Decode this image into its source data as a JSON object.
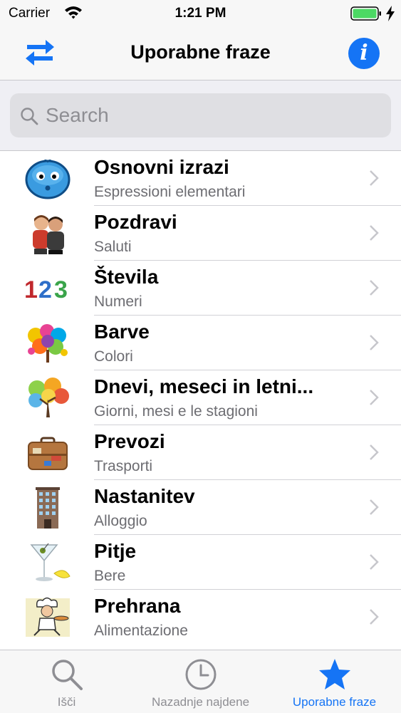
{
  "status_bar": {
    "carrier": "Carrier",
    "time": "1:21 PM"
  },
  "nav": {
    "title": "Uporabne fraze",
    "left_icon": "swap-arrows-icon",
    "right_icon": "info-icon",
    "info_glyph": "i"
  },
  "search": {
    "placeholder": "Search",
    "value": ""
  },
  "colors": {
    "accent": "#1574f5",
    "battery": "#4cd964",
    "separator": "#d1d1d6"
  },
  "list": [
    {
      "title": "Osnovni izrazi",
      "subtitle": "Espressioni elementari",
      "icon": "smiley-face-icon"
    },
    {
      "title": "Pozdravi",
      "subtitle": "Saluti",
      "icon": "greeting-people-icon"
    },
    {
      "title": "Števila",
      "subtitle": "Numeri",
      "icon": "numbers-icon",
      "icon_text": [
        "1",
        "2",
        "3"
      ]
    },
    {
      "title": "Barve",
      "subtitle": "Colori",
      "icon": "color-splash-icon"
    },
    {
      "title": "Dnevi, meseci in letni...",
      "subtitle": "Giorni, mesi e le stagioni",
      "icon": "seasons-tree-icon"
    },
    {
      "title": "Prevozi",
      "subtitle": "Trasporti",
      "icon": "suitcase-icon"
    },
    {
      "title": "Nastanitev",
      "subtitle": "Alloggio",
      "icon": "hotel-building-icon"
    },
    {
      "title": "Pitje",
      "subtitle": "Bere",
      "icon": "cocktail-glass-icon"
    },
    {
      "title": "Prehrana",
      "subtitle": "Alimentazione",
      "icon": "chef-icon"
    }
  ],
  "tabs": [
    {
      "label": "Išči",
      "icon": "search-icon",
      "active": false
    },
    {
      "label": "Nazadnje najdene",
      "icon": "clock-icon",
      "active": false
    },
    {
      "label": "Uporabne fraze",
      "icon": "star-icon",
      "active": true
    }
  ]
}
